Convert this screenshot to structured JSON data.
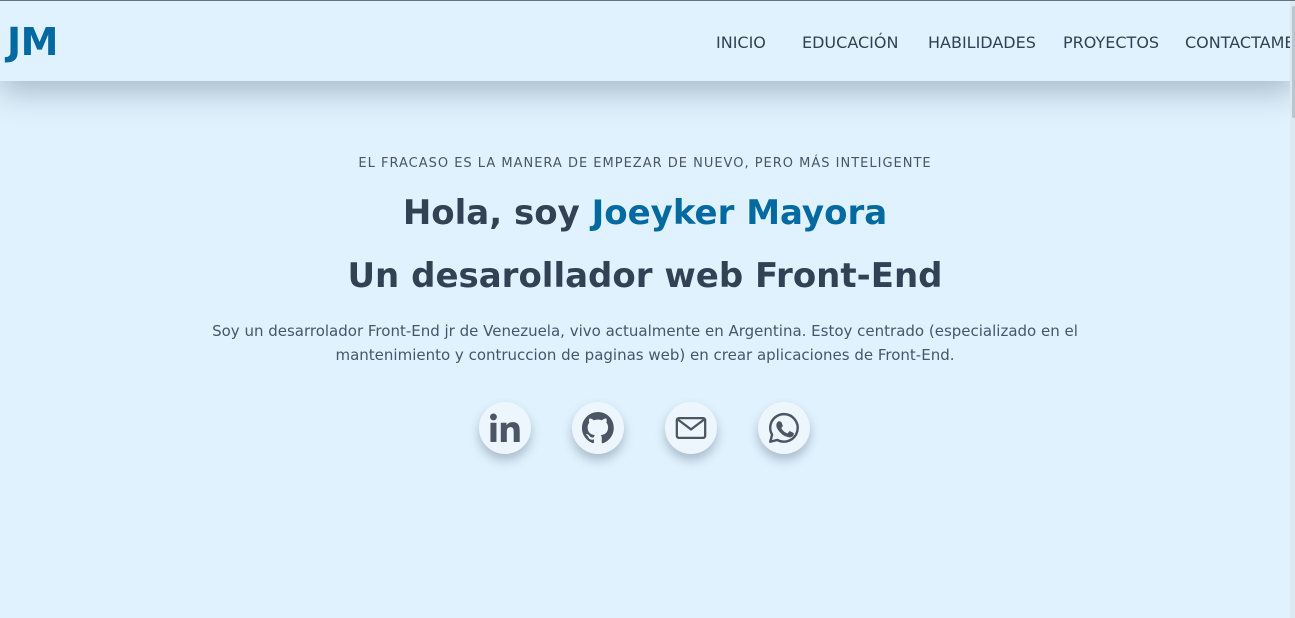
{
  "header": {
    "logo": "JM",
    "nav": [
      {
        "label": "INICIO"
      },
      {
        "label": "EDUCACIÓN"
      },
      {
        "label": "HABILIDADES"
      },
      {
        "label": "PROYECTOS"
      },
      {
        "label": "CONTACTAME"
      }
    ]
  },
  "hero": {
    "tagline": "EL FRACASO ES LA MANERA DE EMPEZAR DE NUEVO, PERO MÁS INTELIGENTE",
    "greeting": "Hola, soy",
    "name": "Joeyker Mayora",
    "role": "Un desarollador web Front-End",
    "description": "Soy un desarrolador Front-End jr de Venezuela, vivo actualmente en Argentina. Estoy centrado (especializado en el mantenimiento y contruccion de paginas web) en crear aplicaciones de Front-End."
  },
  "social": [
    {
      "icon": "linkedin-icon"
    },
    {
      "icon": "github-icon"
    },
    {
      "icon": "mail-icon"
    },
    {
      "icon": "whatsapp-icon"
    }
  ],
  "colors": {
    "background": "#e0f2fe",
    "accent": "#0369a1",
    "heading": "#334155",
    "nav_text": "#4b5563"
  }
}
